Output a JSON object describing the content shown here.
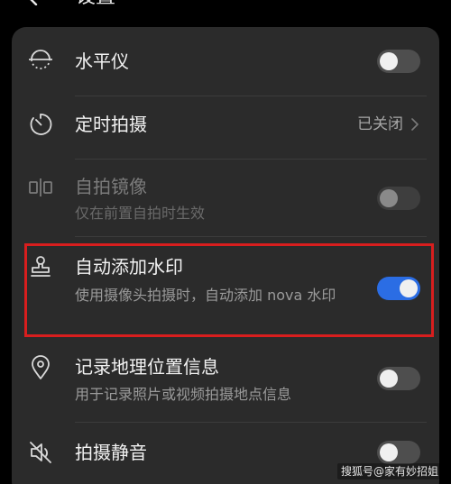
{
  "header": {
    "title": "设置"
  },
  "settings": {
    "level": {
      "label": "水平仪",
      "icon": "level-icon",
      "toggle_on": false
    },
    "timer": {
      "label": "定时拍摄",
      "icon": "timer-icon",
      "value": "已关闭"
    },
    "mirror": {
      "label": "自拍镜像",
      "subtitle": "仅在前置自拍时生效",
      "icon": "mirror-icon",
      "toggle_on": false,
      "enabled": false
    },
    "watermark": {
      "label": "自动添加水印",
      "subtitle": "使用摄像头拍摄时，自动添加 nova 水印",
      "icon": "stamp-icon",
      "toggle_on": true
    },
    "location": {
      "label": "记录地理位置信息",
      "subtitle": "用于记录照片或视频拍摄地点信息",
      "icon": "location-pin-icon",
      "toggle_on": false
    },
    "mute": {
      "label": "拍摄静音",
      "icon": "speaker-mute-icon",
      "toggle_on": false
    }
  },
  "image_watermark": {
    "text": "搜狐号@家有妙招姐"
  },
  "colors": {
    "accent": "#2b6de4",
    "highlight_border": "#d81e1e",
    "panel_bg": "#2b2b2b"
  }
}
